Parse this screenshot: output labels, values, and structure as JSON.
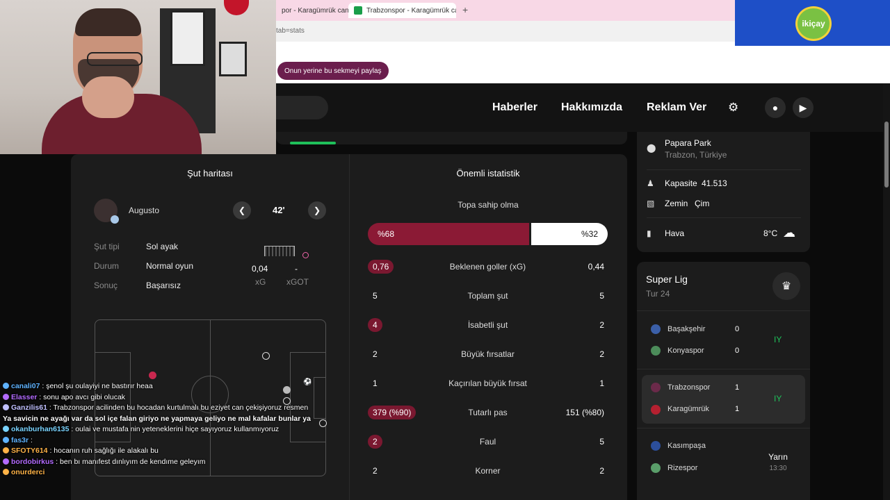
{
  "browser": {
    "tabs": [
      {
        "label": "por - Karagümrük can"
      },
      {
        "label": "Trabzonspor - Karagümrük can"
      }
    ],
    "new_tab": "+",
    "url_fragment": "tab=stats",
    "share_button": "Onun yerine bu sekmeyi paylaş"
  },
  "sponsor": {
    "logo_text": "ikiçay"
  },
  "site_nav": {
    "links": [
      "Haberler",
      "Hakkımızda",
      "Reklam Ver"
    ]
  },
  "shot_map": {
    "title": "Şut haritası",
    "player": "Augusto",
    "minute": "42'",
    "rows": [
      {
        "label": "Şut tipi",
        "value": "Sol ayak"
      },
      {
        "label": "Durum",
        "value": "Normal oyun"
      },
      {
        "label": "Sonuç",
        "value": "Başarısız"
      }
    ],
    "xg_value": "0,04",
    "xg_label": "xG",
    "xgot_value": "-",
    "xgot_label": "xGOT"
  },
  "key_stats": {
    "title": "Önemli istatistik",
    "possession_label": "Topa sahip olma",
    "possession_home": "%68",
    "possession_away": "%32",
    "possession_home_fraction": 0.68,
    "rows": [
      {
        "home": "0,76",
        "label": "Beklenen goller (xG)",
        "away": "0,44",
        "highlight": true
      },
      {
        "home": "5",
        "label": "Toplam şut",
        "away": "5",
        "highlight": false
      },
      {
        "home": "4",
        "label": "İsabetli şut",
        "away": "2",
        "highlight": true
      },
      {
        "home": "2",
        "label": "Büyük fırsatlar",
        "away": "2",
        "highlight": false
      },
      {
        "home": "1",
        "label": "Kaçırılan büyük fırsat",
        "away": "1",
        "highlight": false
      },
      {
        "home": "379 (%90)",
        "label": "Tutarlı pas",
        "away": "151 (%80)",
        "highlight": true
      },
      {
        "home": "2",
        "label": "Faul",
        "away": "5",
        "highlight": true
      },
      {
        "home": "2",
        "label": "Korner",
        "away": "2",
        "highlight": false
      }
    ]
  },
  "venue": {
    "stadium": "Papara Park",
    "city": "Trabzon, Türkiye",
    "capacity_label": "Kapasite",
    "capacity_value": "41.513",
    "surface_label": "Zemin",
    "surface_value": "Çim",
    "weather_label": "Hava",
    "weather_value": "8°C"
  },
  "league": {
    "name": "Super Lig",
    "round": "Tur 24",
    "matches": [
      {
        "home": "Başakşehir",
        "away": "Konyaspor",
        "home_score": "0",
        "away_score": "0",
        "status": "IY"
      },
      {
        "home": "Trabzonspor",
        "away": "Karagümrük",
        "home_score": "1",
        "away_score": "1",
        "status": "IY"
      },
      {
        "home": "Kasımpaşa",
        "away": "Rizespor",
        "when": "Yarın",
        "time": "13:30"
      }
    ]
  },
  "chat": [
    {
      "user": "canali07",
      "text": " : şenol şu oulayiyi ne bastırır heaa",
      "color": "#5fb3ff"
    },
    {
      "user": "Elasser",
      "text": " : sonu apo avcı gibi olucak",
      "color": "#b36bff"
    },
    {
      "user": "Ganzilis61",
      "text": " : Trabzonspor acilinden bu hocadan kurtulmalı bu eziyet can çekişiyoruz resmen",
      "color": "#c0c0ff"
    },
    {
      "user": "Ya savicin ne ayağı var da sol içe falan giriyo ne yapmaya geliyo ne mal kafalar bunlar ya",
      "text": "",
      "color": "#ffffff"
    },
    {
      "user": "okanburhan6135",
      "text": " : oulai ve mustafa nin yeteneklerini hiçe sayıyoruz kullanmıyoruz",
      "color": "#7ad4ff"
    },
    {
      "user": "fas3r",
      "text": " : ",
      "color": "#5fb3ff"
    },
    {
      "user": "SFOTY614",
      "text": " : hocanın ruh sağlığı ile alakalı bu",
      "color": "#ffb347"
    },
    {
      "user": "bordobirkus",
      "text": " : ben bı manıfest dınlıyım de kendıme geleyım",
      "color": "#b36bff"
    },
    {
      "user": "onurderci",
      "text": "",
      "color": "#ffb347"
    }
  ]
}
